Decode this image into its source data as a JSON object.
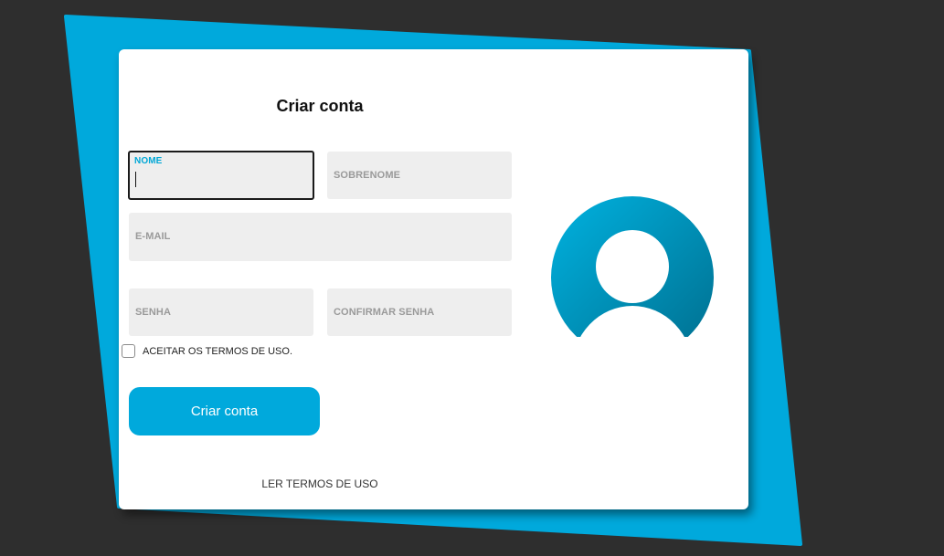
{
  "form": {
    "title": "Criar conta",
    "fields": {
      "first_name_label": "NOME",
      "last_name_label": "SOBRENOME",
      "email_label": "E-MAIL",
      "password_label": "SENHA",
      "confirm_password_label": "CONFIRMAR SENHA"
    },
    "terms_checkbox_label": "ACEITAR OS TERMOS DE USO.",
    "submit_label": "Criar conta",
    "read_terms_link": "LER TERMOS DE USO"
  },
  "colors": {
    "accent": "#00a9dc",
    "background": "#2e2e2e",
    "field_bg": "#eeeeee",
    "avatar_dark": "#007a99"
  },
  "icons": {
    "avatar": "user-avatar-icon"
  }
}
